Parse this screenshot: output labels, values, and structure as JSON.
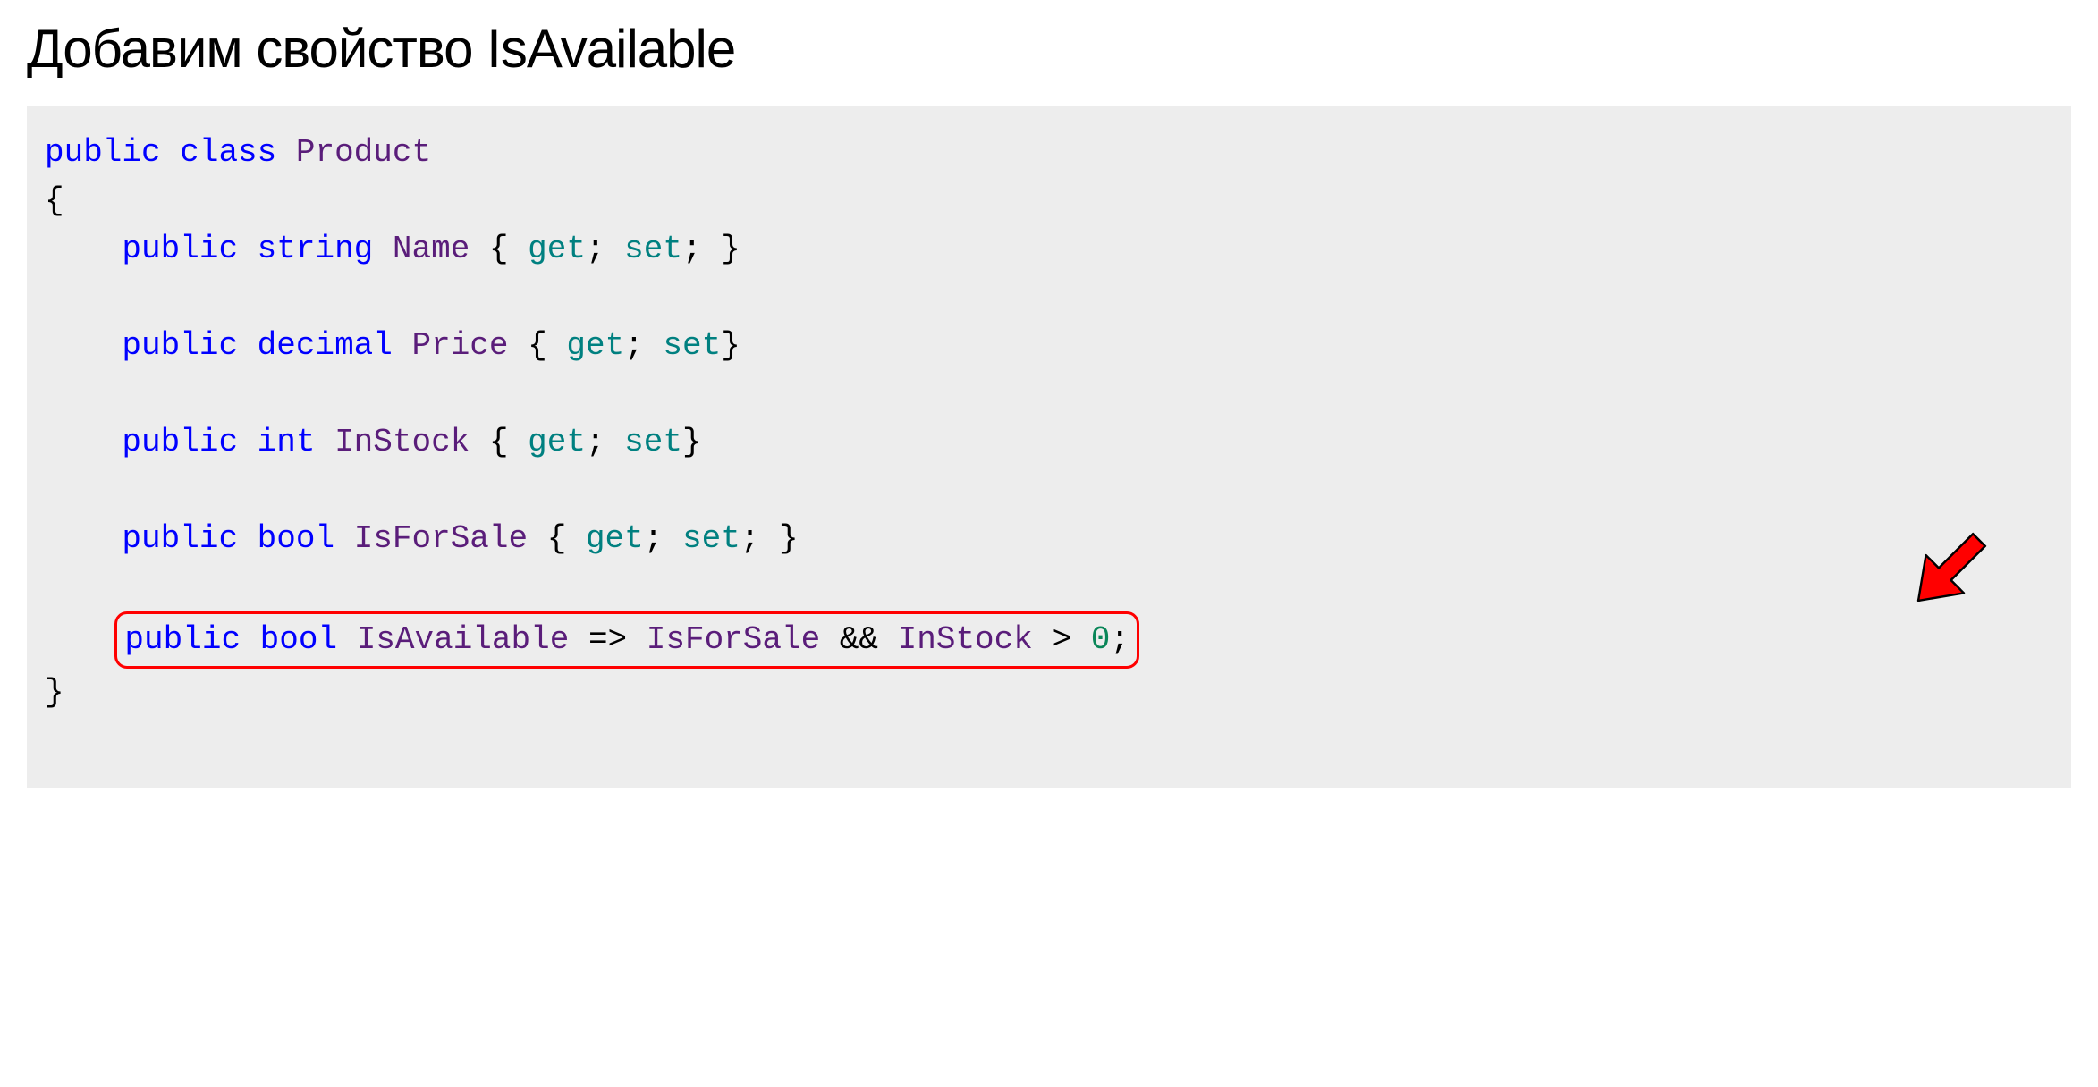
{
  "title": "Добавим свойство IsAvailable",
  "code": {
    "line1_kw1": "public",
    "line1_kw2": "class",
    "line1_type": "Product",
    "brace_open": "{",
    "prop1_kw": "public",
    "prop1_type": "string",
    "prop1_name": "Name",
    "prop1_get": "get",
    "prop1_set": "set",
    "prop2_kw": "public",
    "prop2_type": "decimal",
    "prop2_name": "Price",
    "prop2_get": "get",
    "prop2_set": "set",
    "prop3_kw": "public",
    "prop3_type": "int",
    "prop3_name": "InStock",
    "prop3_get": "get",
    "prop3_set": "set",
    "prop4_kw": "public",
    "prop4_type": "bool",
    "prop4_name": "IsForSale",
    "prop4_get": "get",
    "prop4_set": "set",
    "prop5_kw": "public",
    "prop5_type": "bool",
    "prop5_name": "IsAvailable",
    "prop5_ref1": "IsForSale",
    "prop5_ref2": "InStock",
    "prop5_num": "0",
    "brace_close": "}"
  }
}
